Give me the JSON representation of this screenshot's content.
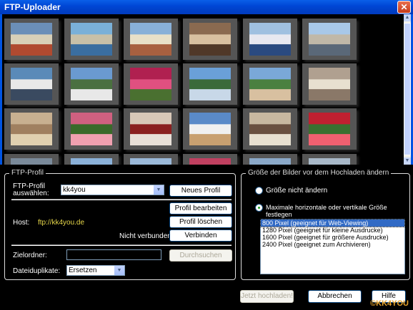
{
  "window": {
    "title": "FTP-Uploader",
    "close_glyph": "✕"
  },
  "thumbnails": [
    {
      "name": "harbor-church",
      "colors": [
        "#6b8fb8",
        "#d8d0b8",
        "#b04a30"
      ]
    },
    {
      "name": "harbor-boats",
      "colors": [
        "#7ab0d8",
        "#c8c0a8",
        "#3a6ea0"
      ]
    },
    {
      "name": "harbor-houses",
      "colors": [
        "#88b0d8",
        "#e8e0c8",
        "#a86040"
      ]
    },
    {
      "name": "taverna",
      "colors": [
        "#8a6a50",
        "#d8c0a0",
        "#503828"
      ]
    },
    {
      "name": "town-hillside",
      "colors": [
        "#a0c0e0",
        "#e8e8f0",
        "#2a4a80"
      ]
    },
    {
      "name": "waterfront-town",
      "colors": [
        "#a8c8e8",
        "#c0b8a8",
        "#5a6878"
      ]
    },
    {
      "name": "sailing-deck",
      "colors": [
        "#5a8ab8",
        "#e8e8e8",
        "#3a4a60"
      ]
    },
    {
      "name": "marina-hills",
      "colors": [
        "#6a9ad0",
        "#4a7040",
        "#e8e8e8"
      ]
    },
    {
      "name": "bougainvillea",
      "colors": [
        "#b02050",
        "#e05080",
        "#4a7030"
      ]
    },
    {
      "name": "coastline",
      "colors": [
        "#6aa0d8",
        "#3a6a3a",
        "#c8d8e8"
      ]
    },
    {
      "name": "village-green",
      "colors": [
        "#7aa8d8",
        "#4a8040",
        "#d8c0a0"
      ]
    },
    {
      "name": "rocky-shore",
      "colors": [
        "#b0a090",
        "#e8e0d0",
        "#8a7868"
      ]
    },
    {
      "name": "cat-sand",
      "colors": [
        "#c8b090",
        "#a08060",
        "#e0d0b0"
      ]
    },
    {
      "name": "oleander",
      "colors": [
        "#d06080",
        "#3a6a2a",
        "#f0a0b0"
      ]
    },
    {
      "name": "sign-plate",
      "colors": [
        "#d8c8b8",
        "#8a2020",
        "#e8e0d8"
      ]
    },
    {
      "name": "white-building",
      "colors": [
        "#5a8ac8",
        "#f0f0f0",
        "#c8a070"
      ]
    },
    {
      "name": "alley-door",
      "colors": [
        "#c8b8a0",
        "#6a5040",
        "#e8e0d0"
      ]
    },
    {
      "name": "red-flowers",
      "colors": [
        "#c02030",
        "#3a7030",
        "#f06070"
      ]
    },
    {
      "name": "row4-a",
      "colors": [
        "#7a8a9a",
        "#c8c0b0",
        "#5a5a5a"
      ]
    },
    {
      "name": "row4-b",
      "colors": [
        "#8ab0d8",
        "#e0e0e0",
        "#6a7a8a"
      ]
    },
    {
      "name": "row4-c",
      "colors": [
        "#9ab8d8",
        "#d8d0c0",
        "#7a6a5a"
      ]
    },
    {
      "name": "row4-d",
      "colors": [
        "#c04060",
        "#6a9ad0",
        "#d8a0a0"
      ]
    },
    {
      "name": "row4-e",
      "colors": [
        "#8aa8c8",
        "#4a6a3a",
        "#d0d0c0"
      ]
    },
    {
      "name": "row4-f",
      "colors": [
        "#a8b8c8",
        "#c0b8a8",
        "#8a8070"
      ]
    }
  ],
  "ftp": {
    "legend": "FTP-Profil",
    "profile_label_line1": "FTP-Profil",
    "profile_label_line2": "auswählen:",
    "profile_value": "kk4you",
    "new_profile": "Neues Profil erstellen",
    "edit_profile": "Profil bearbeiten",
    "delete_profile": "Profil löschen",
    "host_label": "Host:",
    "host_value": "ftp://kk4you.de",
    "status": "Nicht verbunden",
    "connect": "Verbinden",
    "target_label": "Zielordner:",
    "browse": "Durchsuchen",
    "duplicates_label": "Dateiduplikate:",
    "duplicates_value": "Ersetzen"
  },
  "resize": {
    "legend": "Größe der Bilder vor dem Hochladen ändern",
    "option_keep": "Größe nicht ändern",
    "option_set": "Maximale horizontale oder vertikale Größe festlegen",
    "sizes": [
      "800 Pixel (geeignet für Web-Viewing)",
      "1280 Pixel (geeignet für kleine Ausdrucke)",
      "1600 Pixel (geeignet für größere Ausdrucke)",
      "2400 Pixel (geeignet zum Archivieren)"
    ]
  },
  "footer": {
    "upload": "Jetzt hochladen!",
    "cancel": "Abbrechen",
    "help": "Hilfe",
    "watermark": "©KK4YOU"
  }
}
